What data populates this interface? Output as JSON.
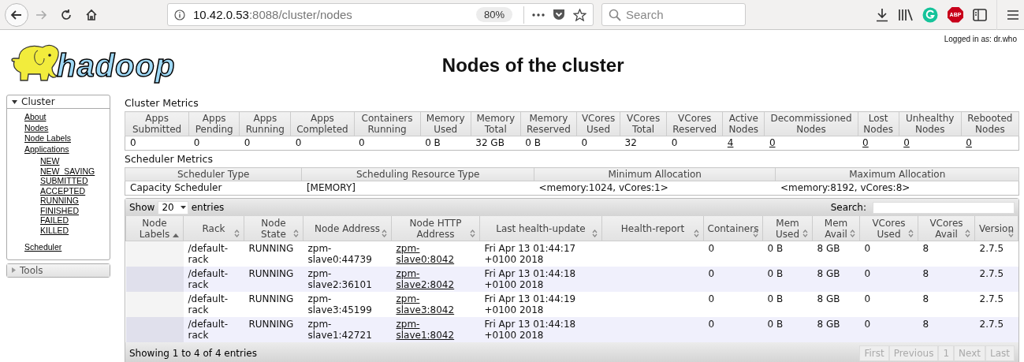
{
  "browser": {
    "url_host": "10.42.0.53",
    "url_path": ":8088/cluster/nodes",
    "zoom": "80%",
    "search_placeholder": "Search",
    "abp_label": "ABP"
  },
  "header": {
    "logo_text": "hadoop",
    "title": "Nodes of the cluster",
    "logged_in": "Logged in as: dr.who"
  },
  "sidebar": [
    {
      "label": "Cluster",
      "expanded": true,
      "groups": [
        [
          {
            "label": "About"
          },
          {
            "label": "Nodes"
          },
          {
            "label": "Node Labels"
          },
          {
            "label": "Applications",
            "children": [
              {
                "label": "NEW"
              },
              {
                "label": "NEW_SAVING"
              },
              {
                "label": "SUBMITTED"
              },
              {
                "label": "ACCEPTED"
              },
              {
                "label": "RUNNING"
              },
              {
                "label": "FINISHED"
              },
              {
                "label": "FAILED"
              },
              {
                "label": "KILLED"
              }
            ]
          }
        ],
        [
          {
            "label": "Scheduler"
          }
        ]
      ]
    },
    {
      "label": "Tools",
      "expanded": false
    }
  ],
  "cluster_metrics": {
    "title": "Cluster Metrics",
    "columns": [
      {
        "label": "Apps Submitted",
        "value": "0",
        "link": false
      },
      {
        "label": "Apps Pending",
        "value": "0",
        "link": false
      },
      {
        "label": "Apps Running",
        "value": "0",
        "link": false
      },
      {
        "label": "Apps Completed",
        "value": "0",
        "link": false
      },
      {
        "label": "Containers Running",
        "value": "0",
        "link": false
      },
      {
        "label": "Memory Used",
        "value": "0 B",
        "link": false
      },
      {
        "label": "Memory Total",
        "value": "32 GB",
        "link": false
      },
      {
        "label": "Memory Reserved",
        "value": "0 B",
        "link": false
      },
      {
        "label": "VCores Used",
        "value": "0",
        "link": false
      },
      {
        "label": "VCores Total",
        "value": "32",
        "link": false
      },
      {
        "label": "VCores Reserved",
        "value": "0",
        "link": false
      },
      {
        "label": "Active Nodes",
        "value": "4",
        "link": true
      },
      {
        "label": "Decommissioned Nodes",
        "value": "0",
        "link": true
      },
      {
        "label": "Lost Nodes",
        "value": "0",
        "link": true
      },
      {
        "label": "Unhealthy Nodes",
        "value": "0",
        "link": true
      },
      {
        "label": "Rebooted Nodes",
        "value": "0",
        "link": true
      }
    ]
  },
  "scheduler_metrics": {
    "title": "Scheduler Metrics",
    "columns": [
      "Scheduler Type",
      "Scheduling Resource Type",
      "Minimum Allocation",
      "Maximum Allocation"
    ],
    "row": [
      "Capacity Scheduler",
      "[MEMORY]",
      "<memory:1024, vCores:1>",
      "<memory:8192, vCores:8>"
    ]
  },
  "nodes_table": {
    "show_label": "Show",
    "page_size": "20",
    "entries_label": "entries",
    "search_label": "Search:",
    "columns": [
      {
        "label": "Node Labels",
        "sorted": true
      },
      {
        "label": "Rack",
        "sorted": false,
        "kind": "text"
      },
      {
        "label": "Node State",
        "sorted": false,
        "kind": "text"
      },
      {
        "label": "Node Address",
        "sorted": false,
        "kind": "text"
      },
      {
        "label": "Node HTTP Address",
        "sorted": false,
        "kind": "link"
      },
      {
        "label": "Last health-update",
        "sorted": false,
        "kind": "text"
      },
      {
        "label": "Health-report",
        "sorted": false
      },
      {
        "label": "Containers",
        "sorted": false,
        "kind": "text"
      },
      {
        "label": "Mem Used",
        "sorted": false,
        "kind": "text"
      },
      {
        "label": "Mem Avail",
        "sorted": false,
        "kind": "text"
      },
      {
        "label": "VCores Used",
        "sorted": false,
        "kind": "text"
      },
      {
        "label": "VCores Avail",
        "sorted": false,
        "kind": "text"
      },
      {
        "label": "Version",
        "sorted": false,
        "kind": "text"
      }
    ],
    "rows": [
      [
        "",
        "/default-rack",
        "RUNNING",
        "zpm-slave0:44739",
        "zpm-slave0:8042",
        "Fri Apr 13 01:44:17 +0100 2018",
        "",
        "0",
        "0 B",
        "8 GB",
        "0",
        "8",
        "2.7.5"
      ],
      [
        "",
        "/default-rack",
        "RUNNING",
        "zpm-slave2:36101",
        "zpm-slave2:8042",
        "Fri Apr 13 01:44:18 +0100 2018",
        "",
        "0",
        "0 B",
        "8 GB",
        "0",
        "8",
        "2.7.5"
      ],
      [
        "",
        "/default-rack",
        "RUNNING",
        "zpm-slave3:45199",
        "zpm-slave3:8042",
        "Fri Apr 13 01:44:19 +0100 2018",
        "",
        "0",
        "0 B",
        "8 GB",
        "0",
        "8",
        "2.7.5"
      ],
      [
        "",
        "/default-rack",
        "RUNNING",
        "zpm-slave1:42721",
        "zpm-slave1:8042",
        "Fri Apr 13 01:44:18 +0100 2018",
        "",
        "0",
        "0 B",
        "8 GB",
        "0",
        "8",
        "2.7.5"
      ]
    ],
    "info": "Showing 1 to 4 of 4 entries",
    "pagination": [
      {
        "label": "First",
        "disabled": true
      },
      {
        "label": "Previous",
        "disabled": true
      },
      {
        "label": "1",
        "disabled": true
      },
      {
        "label": "Next",
        "disabled": true
      },
      {
        "label": "Last",
        "disabled": true
      }
    ]
  }
}
